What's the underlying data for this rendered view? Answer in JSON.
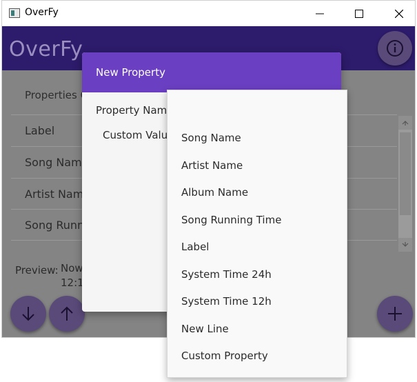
{
  "window": {
    "title": "OverFy",
    "minimize_icon": "minimize-icon",
    "maximize_icon": "maximize-icon",
    "close_icon": "close-icon"
  },
  "appbar": {
    "title": "OverFy",
    "info_icon": "info-icon"
  },
  "properties": {
    "header": "Properties O",
    "rows": [
      {
        "label": "Label"
      },
      {
        "label": "Song Name"
      },
      {
        "label": "Artist Name"
      },
      {
        "label": "Song Runni"
      }
    ]
  },
  "preview": {
    "label": "Preview:",
    "value_line1": "Now",
    "value_line2": "12:1"
  },
  "fabs": {
    "down_icon": "arrow-down-icon",
    "up_icon": "arrow-up-icon",
    "add_icon": "plus-icon"
  },
  "dialog": {
    "title": "New Property",
    "property_name_label": "Property Name",
    "custom_value_label": "Custom Valu"
  },
  "dropdown": {
    "items": [
      "Song Name",
      "Artist Name",
      "Album Name",
      "Song Running Time",
      "Label",
      "System Time 24h",
      "System Time 12h",
      "New Line",
      "Custom Property"
    ]
  },
  "colors": {
    "appbar": "#2d1b6b",
    "dialog_header": "#6a3fc1",
    "fab": "#5a4a7a",
    "overlay_content": "#848484"
  }
}
